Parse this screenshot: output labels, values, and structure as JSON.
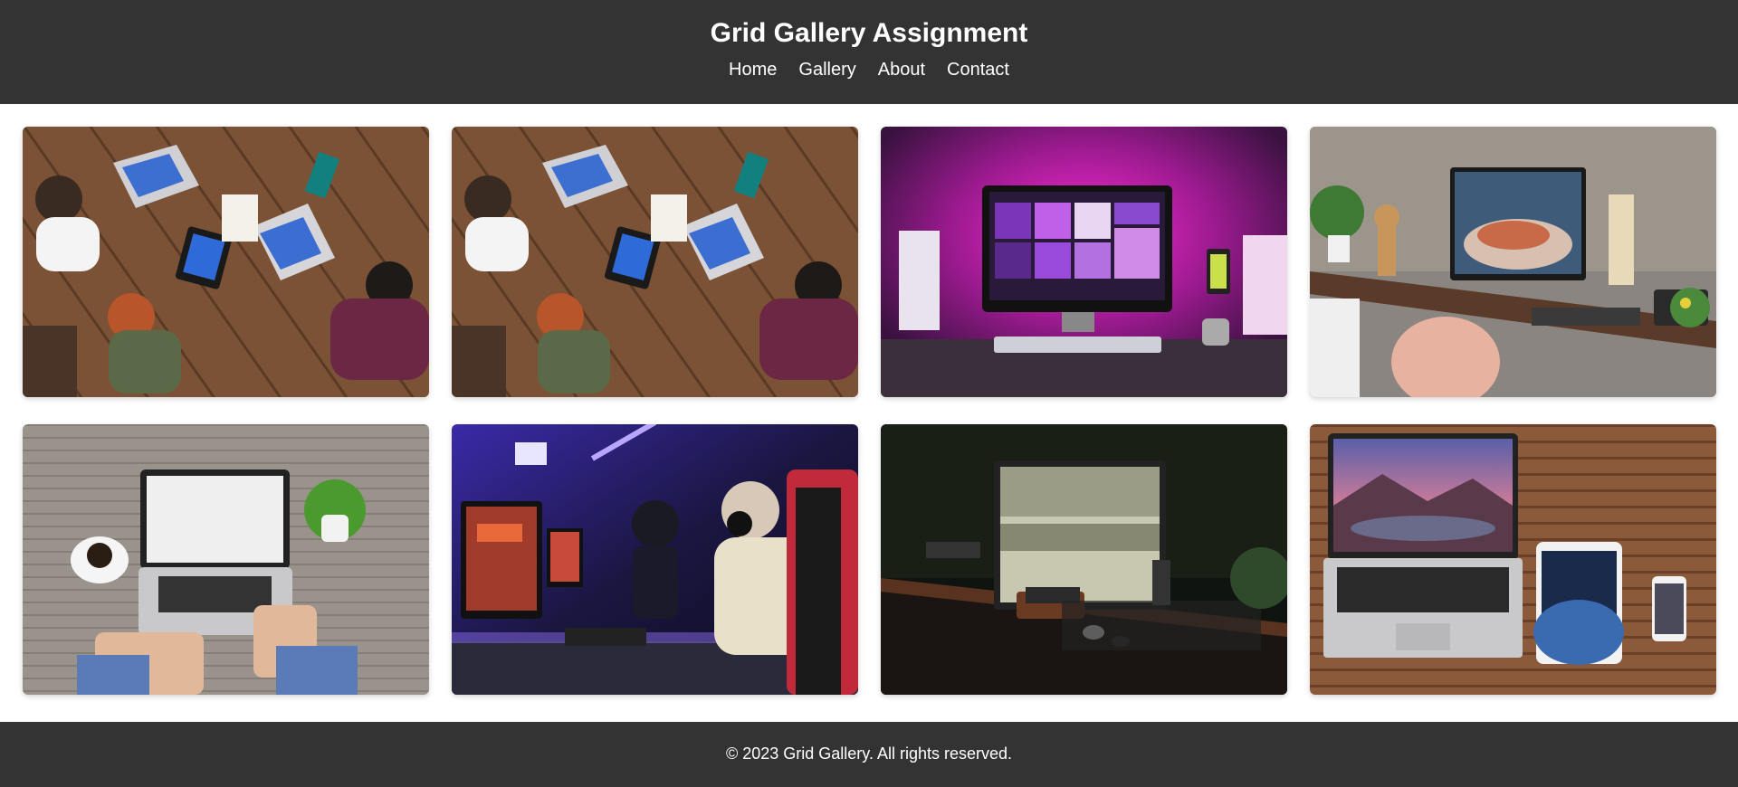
{
  "header": {
    "title": "Grid Gallery Assignment",
    "nav": [
      "Home",
      "Gallery",
      "About",
      "Contact"
    ]
  },
  "gallery": {
    "images": [
      {
        "name": "team-meeting-photo"
      },
      {
        "name": "team-meeting-photo"
      },
      {
        "name": "pink-desk-setup-photo"
      },
      {
        "name": "home-office-desk-photo"
      },
      {
        "name": "laptop-coffee-desk-photo"
      },
      {
        "name": "gaming-esports-photo"
      },
      {
        "name": "dark-desk-monitor-photo"
      },
      {
        "name": "apple-devices-photo"
      }
    ]
  },
  "footer": {
    "text": "© 2023 Grid Gallery. All rights reserved."
  },
  "colors": {
    "header_bg": "#333333",
    "footer_bg": "#333333",
    "text": "#ffffff"
  }
}
